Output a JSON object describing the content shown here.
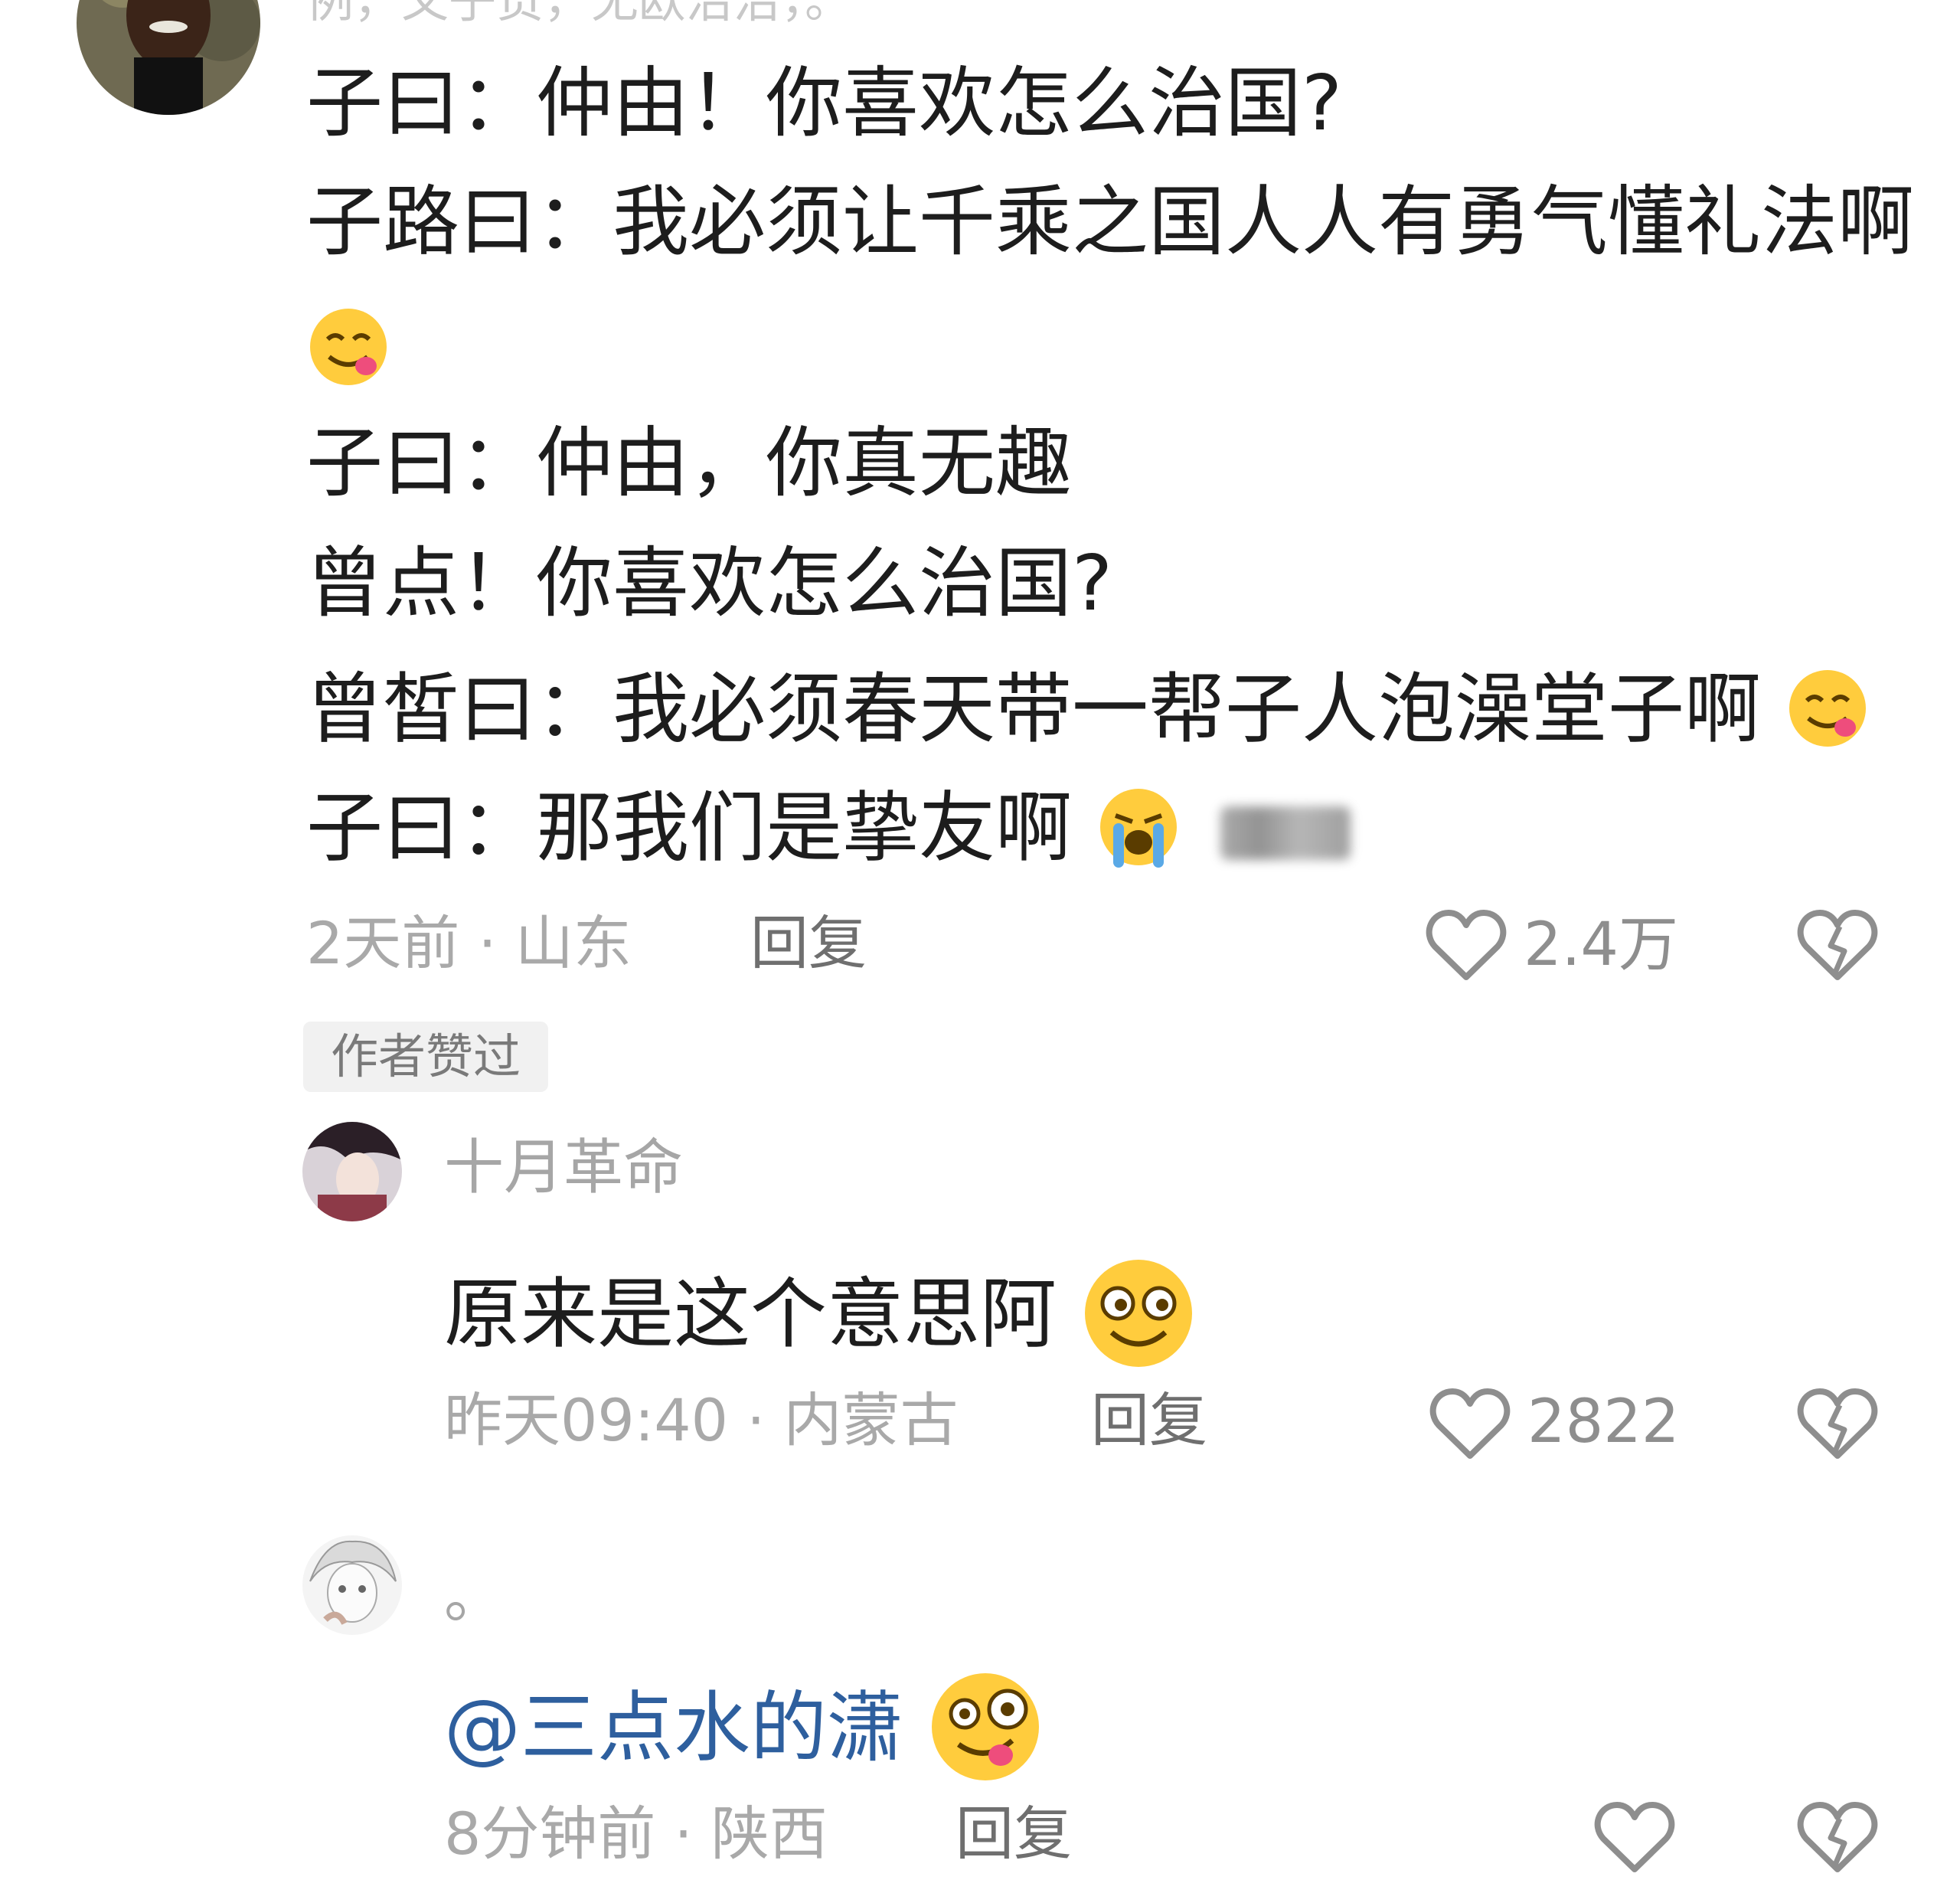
{
  "top_cut_text": "例，又子贡，无欧治治，。",
  "comment1": {
    "lines": [
      "子曰：仲由！你喜欢怎么治国?",
      "子路曰：我必须让千乘之国人人有勇气懂礼法啊",
      "",
      "子曰：仲由，你真无趣",
      "曾点！你喜欢怎么治国?",
      "曾皙曰：我必须春天带一帮子人泡澡堂子啊",
      "子曰：那我们是挚友啊"
    ],
    "time": "2天前",
    "location": "山东",
    "reply": "回复",
    "likes": "2.4万",
    "badge": "作者赞过"
  },
  "comment2": {
    "username": "十月革命",
    "text": "原来是这个意思阿",
    "time": "昨天09:40",
    "location": "内蒙古",
    "reply": "回复",
    "likes": "2822"
  },
  "comment3": {
    "username": "。",
    "mention": "@三点水的潇",
    "time": "8分钟前",
    "location": "陕西",
    "reply": "回复"
  },
  "icons": {
    "like": "heart-outline-icon",
    "dislike": "broken-heart-icon",
    "emoji_yum": "face-savoring-food-emoji",
    "emoji_cry": "loudly-crying-face-emoji",
    "emoji_grin": "grinning-eyes-emoji",
    "emoji_zany": "zany-face-emoji"
  }
}
